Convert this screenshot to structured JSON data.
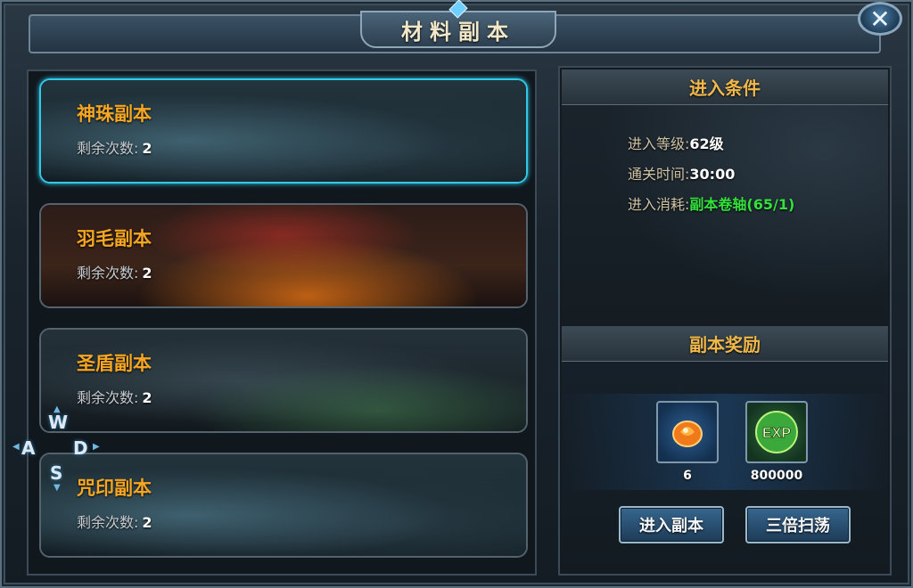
{
  "header": {
    "title": "材料副本",
    "close_label": "✕"
  },
  "dungeons": [
    {
      "name": "神珠副本",
      "remaining_label": "剩余次数:",
      "remaining": "2",
      "selected": true
    },
    {
      "name": "羽毛副本",
      "remaining_label": "剩余次数:",
      "remaining": "2",
      "selected": false
    },
    {
      "name": "圣盾副本",
      "remaining_label": "剩余次数:",
      "remaining": "2",
      "selected": false
    },
    {
      "name": "咒印副本",
      "remaining_label": "剩余次数:",
      "remaining": "2",
      "selected": false
    }
  ],
  "conditions": {
    "title": "进入条件",
    "level_label": "进入等级:",
    "level_value": "62级",
    "time_label": "通关时间:",
    "time_value": "30:00",
    "cost_label": "进入消耗:",
    "cost_value": "副本卷轴(65/1)"
  },
  "rewards": {
    "title": "副本奖励",
    "items": [
      {
        "icon": "orange-gem-icon",
        "count": "6"
      },
      {
        "icon": "exp-orb-icon",
        "label": "EXP",
        "count": "800000"
      }
    ]
  },
  "buttons": {
    "enter": "进入副本",
    "sweep": "三倍扫荡"
  },
  "wasd": {
    "w": "W",
    "a": "A",
    "s": "S",
    "d": "D"
  },
  "colors": {
    "dungeon_name": "#f5a623",
    "section_title": "#f0b84a",
    "cost_highlight": "#33e13c",
    "selected_border": "#32c8e8"
  }
}
